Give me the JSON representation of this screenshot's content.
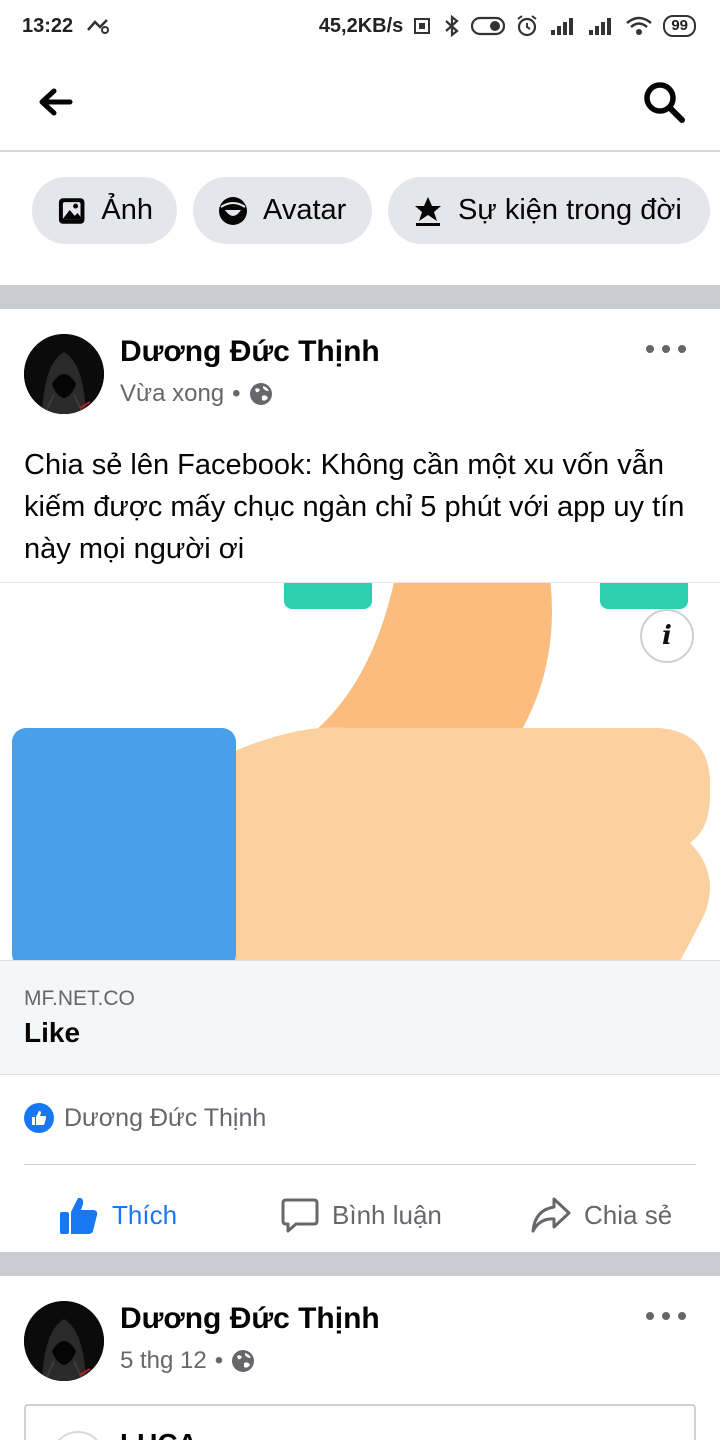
{
  "status_bar": {
    "time": "13:22",
    "net_speed": "45,2KB/s",
    "battery": "99"
  },
  "top_bar": {
    "back_icon": "arrow-left-icon",
    "search_icon": "search-icon"
  },
  "chips": [
    {
      "label": "Ảnh",
      "icon": "photo-icon"
    },
    {
      "label": "Avatar",
      "icon": "avatar-icon"
    },
    {
      "label": "Sự kiện trong đời",
      "icon": "star-flag-icon"
    }
  ],
  "posts": [
    {
      "author": "Dương Đức Thịnh",
      "time": "Vừa xong",
      "separator": "•",
      "privacy_icon": "globe-icon",
      "text": "Chia sẻ lên Facebook: Không cần một xu vốn vẫn kiếm được mấy chục ngàn chỉ 5 phút với app uy tín này mọi người ơi",
      "link": {
        "domain": "MF.NET.CO",
        "title": "Like",
        "info_label": "i"
      },
      "reactions": {
        "icon": "like-badge-icon",
        "names": "Dương Đức Thịnh"
      },
      "actions": {
        "like": "Thích",
        "comment": "Bình luận",
        "share": "Chia sẻ"
      }
    },
    {
      "author": "Dương Đức Thịnh",
      "time": "5 thg 12",
      "separator": "•",
      "privacy_icon": "globe-icon",
      "attachment_title": "LUCA"
    }
  ],
  "colors": {
    "accent": "#1877f2",
    "divider": "#c9ccd1",
    "chip_bg": "#e4e6eb",
    "thumb_light": "#fdd09f",
    "thumb_dark": "#fbbc7d",
    "sleeve": "#4a9fea",
    "cuff": "#2ecfb1"
  }
}
